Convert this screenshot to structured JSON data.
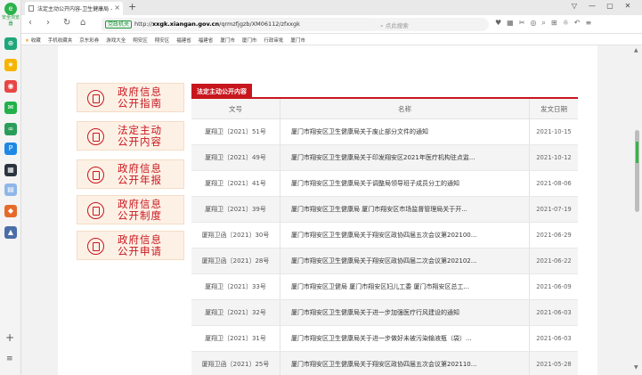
{
  "browser": {
    "tab_title": "法定主动公开内容-卫生健康局 -",
    "new_tab_symbol": "+",
    "url_badge": "党政机关",
    "url_prefix": "http://",
    "url_host": "xxgk.xiangan.gov.cn",
    "url_path": "/qrmzfjgzb/XM06112/zfxxgk",
    "search_placeholder": "点此搜索",
    "sidebar_logo_label": "安全浏览器",
    "bookmarks": [
      "收藏",
      "手机收藏夹",
      "京东彩券",
      "游戏大全",
      "翔安区",
      "翔安区",
      "福建省",
      "福建省",
      "厦门市",
      "厦门市",
      "行政审批",
      "厦门市"
    ]
  },
  "menu": [
    {
      "label": "政府信息公开指南"
    },
    {
      "label": "法定主动公开内容"
    },
    {
      "label": "政府信息公开年报"
    },
    {
      "label": "政府信息公开制度"
    },
    {
      "label": "政府信息公开申请"
    }
  ],
  "table": {
    "caption": "法定主动公开内容",
    "headers": {
      "doc_no": "文号",
      "name": "名称",
      "date": "发文日期"
    },
    "rows": [
      {
        "doc_no": "厦翔卫〔2021〕51号",
        "name": "厦门市翔安区卫生健康局关于废止部分文件的通知",
        "date": "2021-10-15"
      },
      {
        "doc_no": "厦翔卫〔2021〕49号",
        "name": "厦门市翔安区卫生健康局关于印发翔安区2021年医疗机构驻点监...",
        "date": "2021-10-12"
      },
      {
        "doc_no": "厦翔卫〔2021〕41号",
        "name": "厦门市翔安区卫生健康局关于调整局领导班子成员分工的通知",
        "date": "2021-08-06"
      },
      {
        "doc_no": "厦翔卫〔2021〕39号",
        "name": "厦门市翔安区卫生健康局 厦门市翔安区市场监督管理局关于开...",
        "date": "2021-07-19"
      },
      {
        "doc_no": "厦翔卫函〔2021〕30号",
        "name": "厦门市翔安区卫生健康局关于翔安区政协四届五次会议第202100...",
        "date": "2021-06-29"
      },
      {
        "doc_no": "厦翔卫函〔2021〕28号",
        "name": "厦门市翔安区卫生健康局关于翔安区政协四届二次会议第202102...",
        "date": "2021-06-22"
      },
      {
        "doc_no": "厦翔卫〔2021〕33号",
        "name": "厦门市翔安区卫健局 厦门市翔安区妇儿工委 厦门市翔安区总工...",
        "date": "2021-06-09"
      },
      {
        "doc_no": "厦翔卫〔2021〕32号",
        "name": "厦门市翔安区卫生健康局关于进一步加强医疗行风建设的通知",
        "date": "2021-06-03"
      },
      {
        "doc_no": "厦翔卫〔2021〕31号",
        "name": "厦门市翔安区卫生健康局关于进一步做好未被污染输液瓶（袋）...",
        "date": "2021-06-03"
      },
      {
        "doc_no": "厦翔卫函〔2021〕25号",
        "name": "厦门市翔安区卫生健康局关于翔安区政协四届五次会议第202110...",
        "date": "2021-05-28"
      }
    ]
  },
  "colors": {
    "accent_red": "#c8161d",
    "menu_bg": "#fdf1e6"
  }
}
